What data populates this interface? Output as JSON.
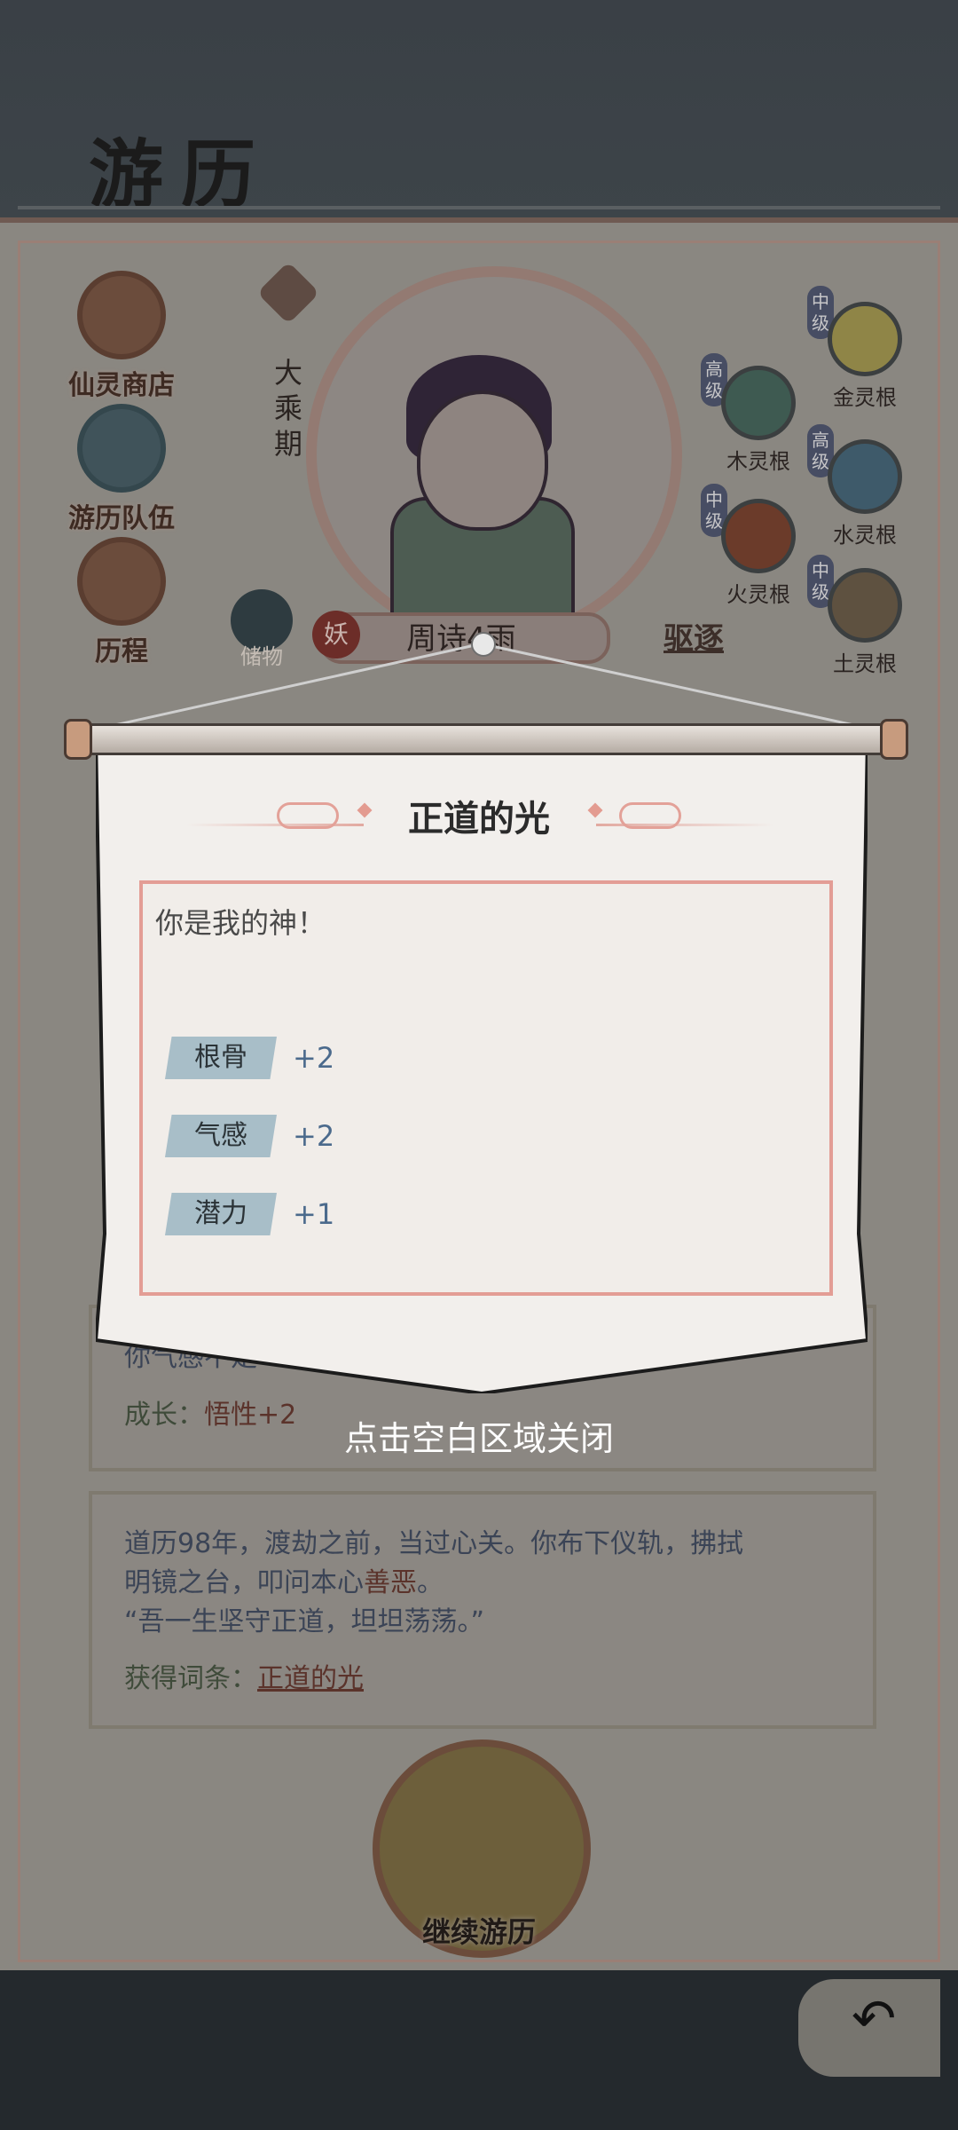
{
  "header": {
    "title": "游历"
  },
  "side_menu": [
    {
      "label": "仙灵商店",
      "icon": "shop-icon"
    },
    {
      "label": "游历队伍",
      "icon": "team-icon"
    },
    {
      "label": "历程",
      "icon": "scroll-icon"
    }
  ],
  "character": {
    "realm": "大乘期",
    "tag": "妖",
    "name": "周诗4雨",
    "expel_label": "驱逐",
    "stash_label": "储物"
  },
  "spirit_roots": [
    {
      "grade": "中级",
      "label": "金灵根",
      "color": "#8f8547"
    },
    {
      "grade": "高级",
      "label": "木灵根",
      "color": "#3e5a51"
    },
    {
      "grade": "高级",
      "label": "水灵根",
      "color": "#3e5a6a"
    },
    {
      "grade": "中级",
      "label": "火灵根",
      "color": "#6b3b2a"
    },
    {
      "grade": "中级",
      "label": "土灵根",
      "color": "#5e5140"
    }
  ],
  "log": {
    "partial_line": "你气感不足",
    "growth_label": "成长：",
    "growth_value": "悟性+2",
    "entry_line1": "道历98年，渡劫之前，当过心关。你布下仪轨，拂拭",
    "entry_line2_a": "明镜之台，叩问本心",
    "entry_line2_b": "善恶",
    "entry_line2_c": "。",
    "entry_line3": "“吾一生坚守正道，坦坦荡荡。”",
    "gain_label": "获得词条：",
    "gain_value": "正道的光"
  },
  "continue_label": "继续游历",
  "modal": {
    "title": "正道的光",
    "text": "你是我的神！",
    "stats": [
      {
        "name": "根骨",
        "value": "+2"
      },
      {
        "name": "气感",
        "value": "+2"
      },
      {
        "name": "潜力",
        "value": "+1"
      }
    ],
    "close_hint": "点击空白区域关闭"
  }
}
